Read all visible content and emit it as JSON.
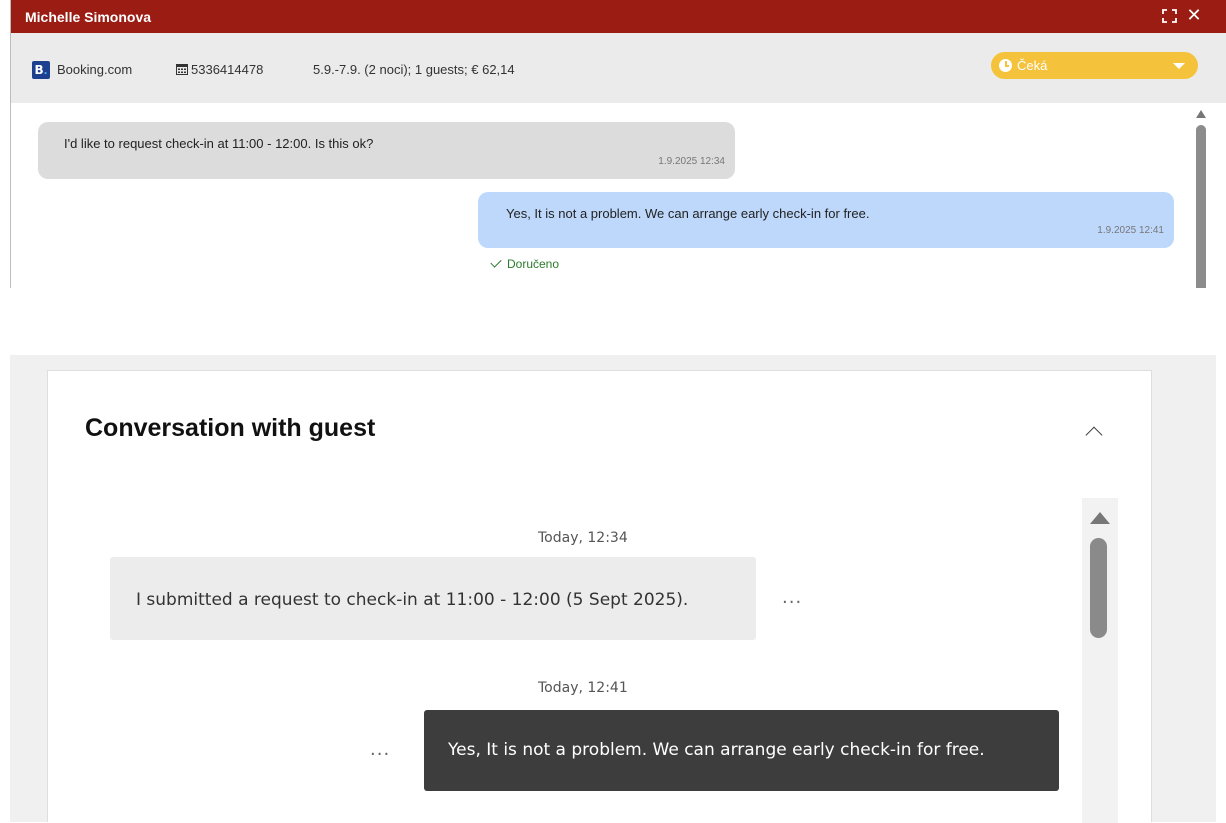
{
  "window": {
    "title": "Michelle Simonova",
    "icons": {
      "maximize": "maximize-icon",
      "close": "close-icon"
    },
    "close_glyph": "✕"
  },
  "reservation": {
    "channel": "Booking.com",
    "channel_logo": "B.",
    "reservation_id": "5336414478",
    "stay_summary": "5.9.-7.9. (2 noci); 1 guests; € 62,14",
    "status": "Čeká",
    "status_color": "#f4c33b"
  },
  "messages_top": [
    {
      "direction": "in",
      "text": "I'd like to request check-in at 11:00 - 12:00. Is this ok?",
      "time": "1.9.2025 12:34"
    },
    {
      "direction": "out",
      "text": "Yes, It is not a problem. We can arrange early check-in for free.",
      "time": "1.9.2025 12:41",
      "delivery": "Doručeno"
    }
  ],
  "conversation": {
    "heading": "Conversation with guest",
    "messages": [
      {
        "timestamp": "Today, 12:34",
        "direction": "in",
        "text": "I submitted a request to check-in at 11:00 - 12:00 (5 Sept 2025).",
        "more": "..."
      },
      {
        "timestamp": "Today, 12:41",
        "direction": "out",
        "text": "Yes, It is not a problem. We can arrange early check-in for free.",
        "more": "..."
      }
    ]
  },
  "colors": {
    "titlebar": "#9b1c12",
    "outgoing_top": "#bed8fb",
    "outgoing_bottom": "#3d3d3d"
  }
}
